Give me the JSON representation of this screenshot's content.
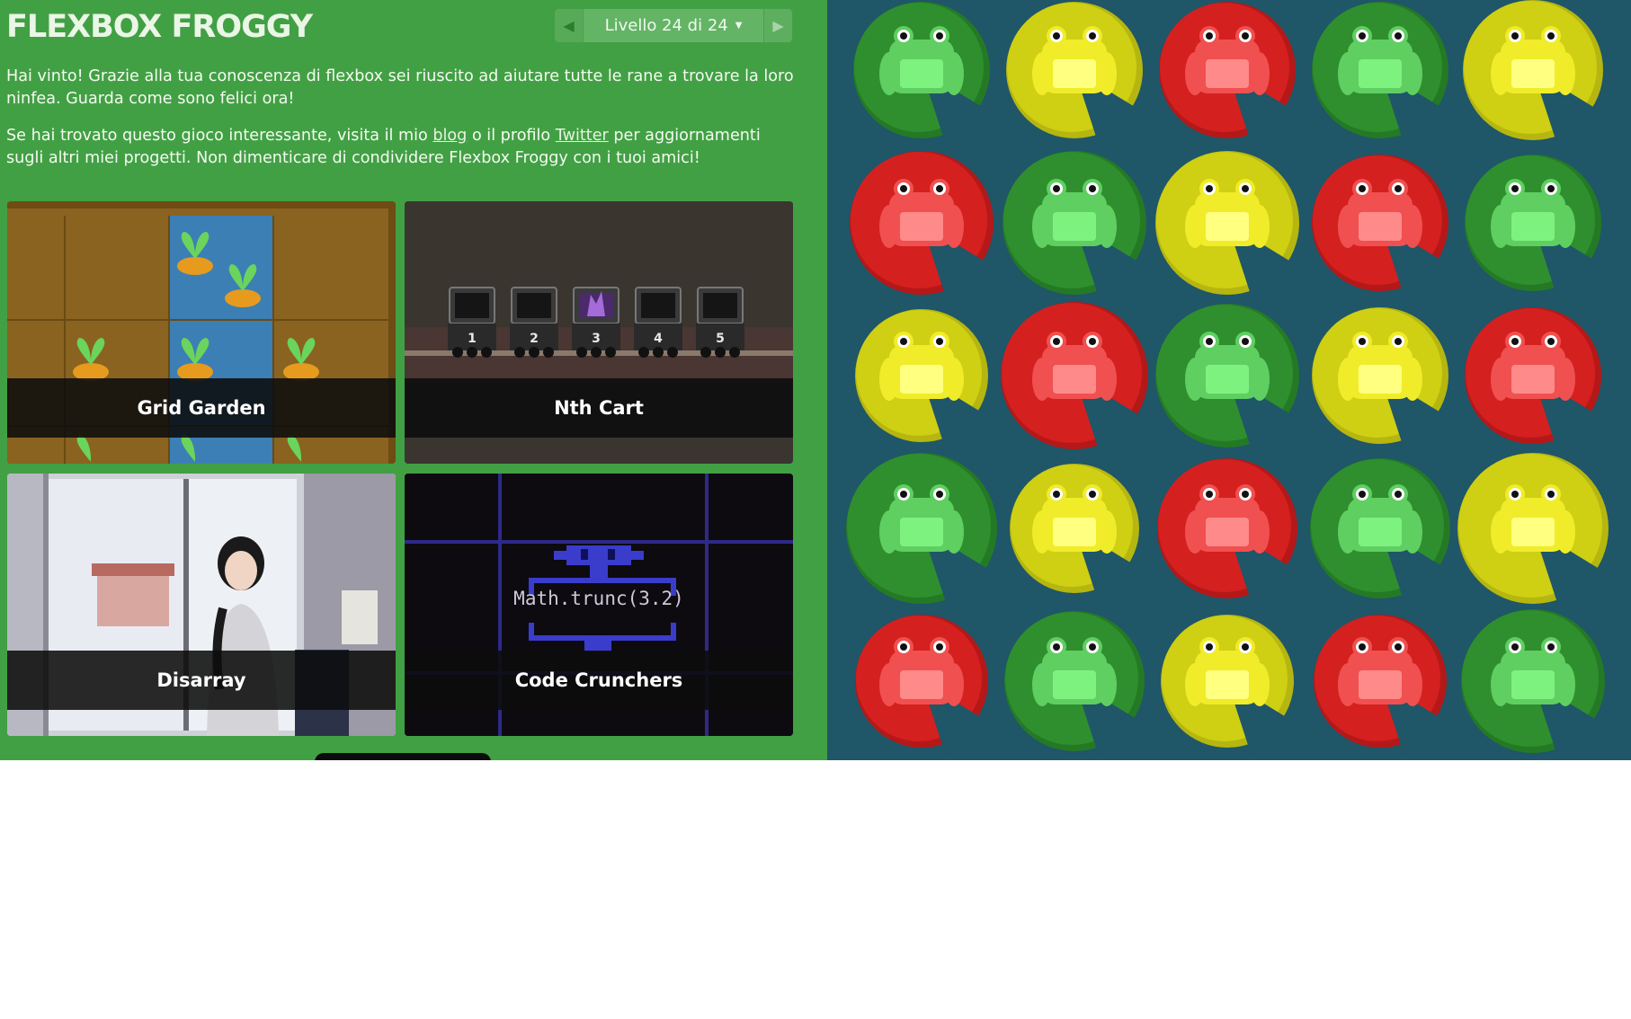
{
  "header": {
    "title": "FLEXBOX FROGGY",
    "level_label": "Livello 24 di 24"
  },
  "message": {
    "p1": "Hai vinto! Grazie alla tua conoscenza di flexbox sei riuscito ad aiutare tutte le rane a trovare la loro ninfea. Guarda come sono felici ora!",
    "p2_before": "Se hai trovato questo gioco interessante, visita il mio ",
    "p2_blog": "blog",
    "p2_middle": " o il profilo ",
    "p2_twitter": "Twitter",
    "p2_after": " per aggiornamenti sugli altri miei progetti. Non dimenticare di condividere Flexbox Froggy con i tuoi amici!"
  },
  "games": [
    {
      "name": "Grid Garden"
    },
    {
      "name": "Nth Cart",
      "carts": [
        "1",
        "2",
        "3",
        "4",
        "5"
      ]
    },
    {
      "name": "Disarray"
    },
    {
      "name": "Code Crunchers",
      "code": "Math.trunc(3.2)"
    }
  ],
  "colors": {
    "green": "#2f8f2e",
    "yellow": "#cfcf14",
    "red": "#d52020",
    "frog_green": "#5fcf62",
    "frog_yellow": "#f0ec2a",
    "frog_red": "#f05050"
  },
  "board": {
    "rows": [
      [
        "green",
        "yellow",
        "red",
        "green",
        "yellow"
      ],
      [
        "red",
        "green",
        "yellow",
        "red",
        "green"
      ],
      [
        "yellow",
        "red",
        "green",
        "yellow",
        "red"
      ],
      [
        "green",
        "yellow",
        "red",
        "green",
        "yellow"
      ],
      [
        "red",
        "green",
        "yellow",
        "red",
        "green"
      ]
    ]
  }
}
